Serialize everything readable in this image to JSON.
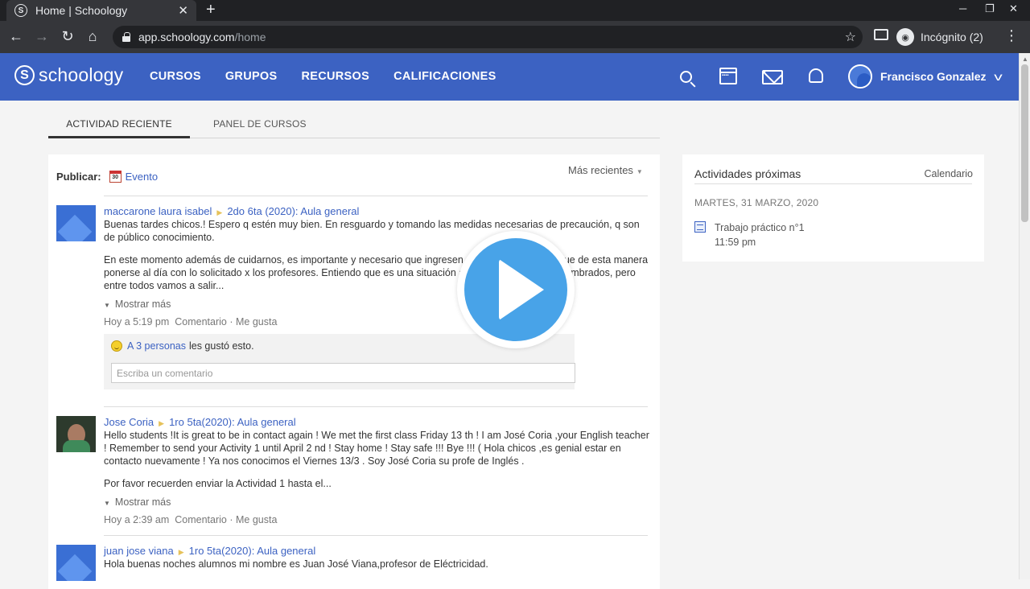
{
  "browser": {
    "tab_title": "Home | Schoology",
    "tab_favicon": "S",
    "url_host": "app.schoology.com",
    "url_path": "/home",
    "profile_label": "Incógnito (2)",
    "icons": [
      "back-icon",
      "forward-icon",
      "reload-icon",
      "home-icon",
      "lock-icon",
      "star-icon",
      "cast-icon",
      "incognito-icon",
      "menu-icon"
    ]
  },
  "header": {
    "logo_text": "schoology",
    "logo_mark": "S",
    "nav": [
      "CURSOS",
      "GRUPOS",
      "RECURSOS",
      "CALIFICACIONES"
    ],
    "user_name": "Francisco Gonzalez",
    "brand_color": "#3c62c2"
  },
  "tabs": [
    "ACTIVIDAD RECIENTE",
    "PANEL DE CURSOS"
  ],
  "feed": {
    "publish_label": "Publicar:",
    "event_icon_text": "30",
    "event_label": "Evento",
    "sort_label": "Más recientes",
    "posts": [
      {
        "author": "maccarone laura isabel",
        "course": "2do 6ta (2020): Aula general",
        "para1": "Buenas tardes chicos.! Espero q estén muy bien. En resguardo y tomando las medidas necesarias de precaución,  q son  de público conocimiento.",
        "para2": "En este momento además de cuidarnos, es importante y necesario que ingresen a la plataforma para que de esta manera ponerse al día con lo solicitado x los profesores. Entiendo que es una situación a la q no estamos acostumbrados, pero entre todos vamos a salir...",
        "show_more": "Mostrar más",
        "time": "Hoy a 5:19 pm",
        "comment_link": "Comentario",
        "like_link": "Me gusta",
        "likes_count": "A 3 personas",
        "likes_text": "les gustó esto.",
        "comment_placeholder": "Escriba un comentario"
      },
      {
        "author": "Jose Coria",
        "course": "1ro 5ta(2020): Aula general",
        "para1": "Hello students !It is great to be in contact again ! We met the first class Friday 13 th ! I am José Coria ,your English teacher ! Remember to send your Activity 1 until April 2 nd ! Stay home ! Stay safe !!! Bye !!! ( Hola chicos ,es genial estar en contacto nuevamente ! Ya nos conocimos el Viernes 13/3 . Soy José Coria su profe de Inglés .",
        "para2": "Por favor recuerden enviar la Actividad 1 hasta el...",
        "show_more": "Mostrar más",
        "time": "Hoy a 2:39 am",
        "comment_link": "Comentario",
        "like_link": "Me gusta"
      },
      {
        "author": "juan jose viana",
        "course": "1ro 5ta(2020): Aula general",
        "para1": "Hola buenas noches alumnos mi nombre es Juan José Viana,profesor de Eléctricidad."
      }
    ]
  },
  "upcoming": {
    "title": "Actividades próximas",
    "calendar_link": "Calendario",
    "date": "MARTES, 31 MARZO, 2020",
    "item_title": "Trabajo práctico n°1",
    "item_time": "11:59 pm"
  },
  "overlay": {
    "play_color": "#48a3e8"
  }
}
